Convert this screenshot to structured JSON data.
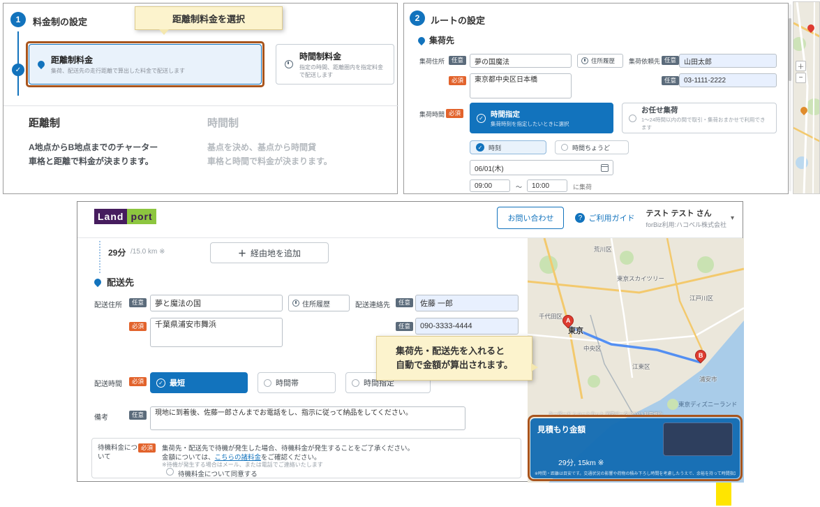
{
  "badges": {
    "optional": "任意",
    "required": "必須"
  },
  "icons": {
    "check": "✓",
    "plus": "＋",
    "minus": "−",
    "chevron_down": "▾",
    "question": "?"
  },
  "fare_panel": {
    "step": "1",
    "title": "料金制の設定",
    "tooltip": "距離制料金を選択",
    "distance_card": {
      "title": "距離制料金",
      "desc": "集荷、配送先の走行距離で算出した料金で配送します"
    },
    "time_card": {
      "title": "時間制料金",
      "desc": "指定の時間、距離圏内を指定料金で配送します"
    },
    "distance_detail": {
      "title": "距離制",
      "body": "A地点からB地点までのチャーター\n車格と距離で料金が決まります。"
    },
    "time_detail": {
      "title": "時間制",
      "body": "基点を決め、基点から時間貸\n車格と時間で料金が決まります。"
    }
  },
  "route_panel": {
    "step": "2",
    "title": "ルートの設定",
    "pickup": {
      "section_title": "集荷先",
      "address_label": "集荷住所",
      "address_value": "夢の国魔法",
      "history_button": "住所履歴",
      "contact_label": "集荷依頼先",
      "contact_value": "山田太郎",
      "address_detail_value": "東京都中央区日本橋",
      "phone_value": "03-1111-2222",
      "time_label": "集荷時間",
      "time_option_selected": {
        "title": "時間指定",
        "desc": "集荷時刻を指定したいときに選択"
      },
      "time_option_alt": {
        "title": "お任せ集荷",
        "desc": "1～24時間以内の間で取引・集荷おまかせで利用できます"
      },
      "mode_selected": "時刻",
      "mode_alt": "時間ちょうど",
      "date_value": "06/01(木)",
      "time_from": "09:00",
      "time_separator": "～",
      "time_to": "10:00",
      "time_suffix": "に集荷"
    }
  },
  "app": {
    "header": {
      "logo_land": "Land",
      "logo_port": "port",
      "contact_button": "お問い合わせ",
      "guide_link": "ご利用ガイド",
      "user_name": "テスト テスト さん",
      "user_org": "forBiz利用:ハコベル株式会社"
    },
    "route_summary": {
      "duration": "29分",
      "distance": "/15.0 km ※",
      "add_waypoint": "経由地を追加"
    },
    "delivery": {
      "section_title": "配送先",
      "address_label": "配送住所",
      "address_value": "夢と魔法の国",
      "history_button": "住所履歴",
      "contact_label": "配送連絡先",
      "contact_value": "佐藤 一郎",
      "address_detail_value": "千葉県浦安市舞浜",
      "phone_value": "090-3333-4444",
      "time_label": "配送時間",
      "time_chip_selected": "最短",
      "time_chip_2": "時間帯",
      "time_chip_3": "時間指定",
      "notes_label": "備考",
      "notes_value": "現地に到着後、佐藤一郎さんまでお電話をし、指示に従って納品をしてください。",
      "wait_fee_label": "待機料金について",
      "wait_fee_text1": "集荷先・配送先で待機が発生した場合、待機料金が発生することをご了承ください。",
      "wait_fee_text2_pre": "金額については、",
      "wait_fee_link": "こちらの諸料金",
      "wait_fee_text2_post": "をご確認ください。",
      "wait_fee_note": "※待機が発生する場合はメール、または電話でご連絡いたします",
      "wait_fee_agree": "待機料金について同意する"
    },
    "estimate_tooltip": "集荷先・配送先を入れると\n自動で金額が算出されます。",
    "map": {
      "labels": [
        "荒川区",
        "東京スカイツリー",
        "江戸川区",
        "千代田区",
        "東京",
        "中央区",
        "江東区",
        "浦安市",
        "東京ディズニーランド"
      ],
      "marker_a": "A",
      "marker_b": "B",
      "attribution": "キーボード ショートカット   地図データ ©2023   利用規約",
      "estimate": {
        "title": "見積もり金額",
        "summary": "29分, 15km ※",
        "note": "※時間・距離は目安です。交通状況の影響や荷物の積み下ろし時間を考慮したうえで、余裕を持って時間指定してください。"
      }
    }
  }
}
